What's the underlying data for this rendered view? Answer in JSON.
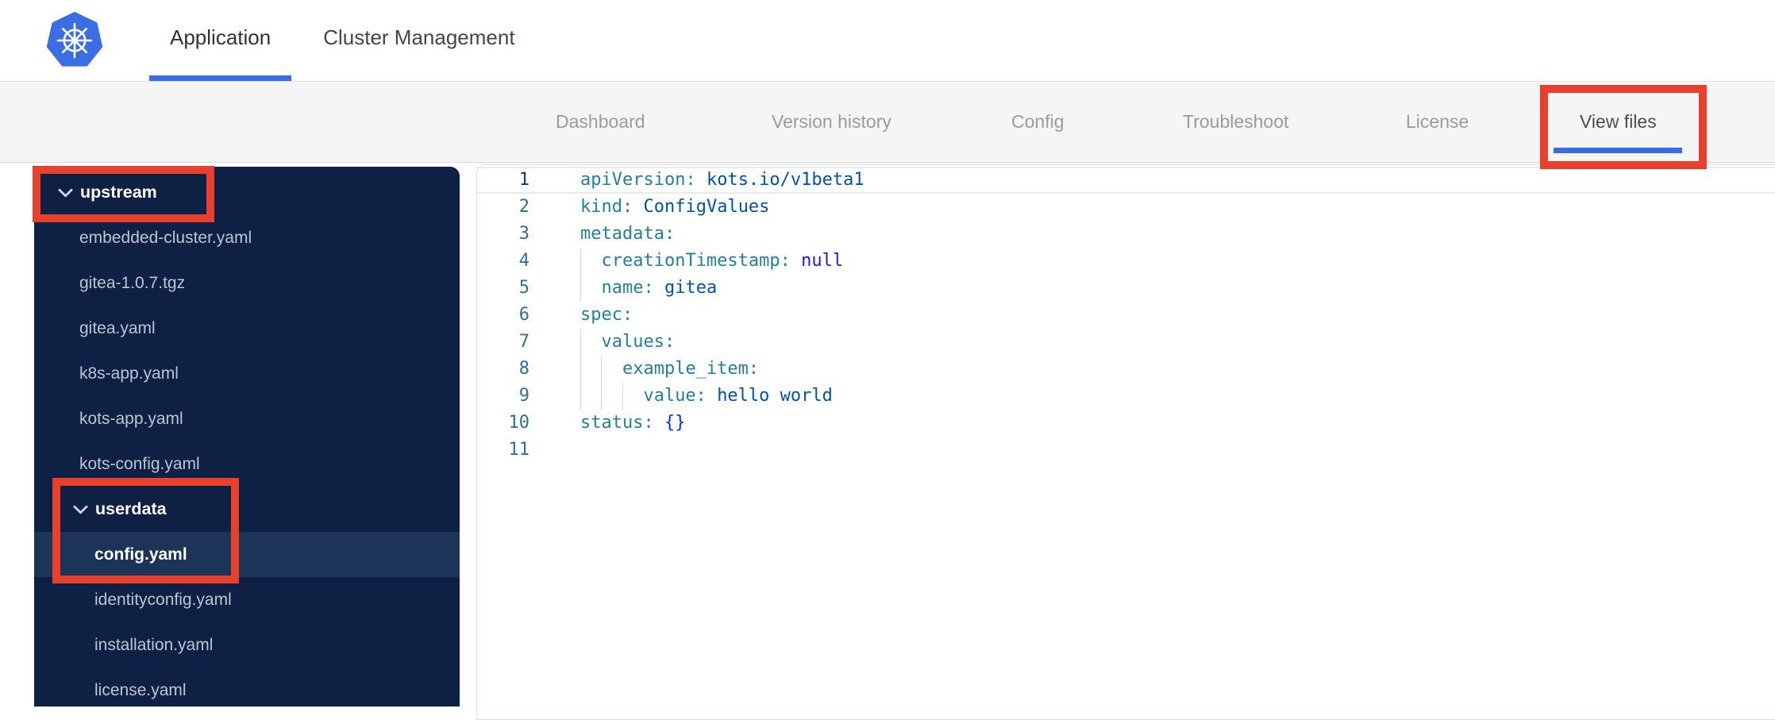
{
  "header": {
    "logo": "kubernetes-logo",
    "tabs": [
      {
        "label": "Application",
        "active": true
      },
      {
        "label": "Cluster Management",
        "active": false
      }
    ]
  },
  "subnav": {
    "tabs": [
      {
        "label": "Dashboard",
        "active": false
      },
      {
        "label": "Version history",
        "active": false
      },
      {
        "label": "Config",
        "active": false
      },
      {
        "label": "Troubleshoot",
        "active": false
      },
      {
        "label": "License",
        "active": false
      },
      {
        "label": "View files",
        "active": true,
        "annotated": true
      }
    ]
  },
  "file_tree": {
    "items": [
      {
        "kind": "folder",
        "label": "upstream",
        "level": 0,
        "expanded": true,
        "annotated": true
      },
      {
        "kind": "file",
        "label": "embedded-cluster.yaml",
        "level": 1
      },
      {
        "kind": "file",
        "label": "gitea-1.0.7.tgz",
        "level": 1
      },
      {
        "kind": "file",
        "label": "gitea.yaml",
        "level": 1
      },
      {
        "kind": "file",
        "label": "k8s-app.yaml",
        "level": 1
      },
      {
        "kind": "file",
        "label": "kots-app.yaml",
        "level": 1
      },
      {
        "kind": "file",
        "label": "kots-config.yaml",
        "level": 1
      },
      {
        "kind": "folder",
        "label": "userdata",
        "level": 1,
        "expanded": true,
        "annotated": true
      },
      {
        "kind": "file",
        "label": "config.yaml",
        "level": 2,
        "selected": true,
        "annotated": true
      },
      {
        "kind": "file",
        "label": "identityconfig.yaml",
        "level": 2
      },
      {
        "kind": "file",
        "label": "installation.yaml",
        "level": 2
      },
      {
        "kind": "file",
        "label": "license.yaml",
        "level": 2
      }
    ]
  },
  "editor": {
    "language": "yaml",
    "lines": [
      {
        "n": 1,
        "indent": 0,
        "active": true,
        "tokens": [
          [
            "key",
            "apiVersion:"
          ],
          [
            "plain",
            " "
          ],
          [
            "val",
            "kots.io/v1beta1"
          ]
        ]
      },
      {
        "n": 2,
        "indent": 0,
        "tokens": [
          [
            "key",
            "kind:"
          ],
          [
            "plain",
            " "
          ],
          [
            "val",
            "ConfigValues"
          ]
        ]
      },
      {
        "n": 3,
        "indent": 0,
        "tokens": [
          [
            "key",
            "metadata:"
          ]
        ]
      },
      {
        "n": 4,
        "indent": 1,
        "tokens": [
          [
            "key",
            "creationTimestamp:"
          ],
          [
            "plain",
            " "
          ],
          [
            "kw",
            "null"
          ]
        ]
      },
      {
        "n": 5,
        "indent": 1,
        "tokens": [
          [
            "key",
            "name:"
          ],
          [
            "plain",
            " "
          ],
          [
            "val",
            "gitea"
          ]
        ]
      },
      {
        "n": 6,
        "indent": 0,
        "tokens": [
          [
            "key",
            "spec:"
          ]
        ]
      },
      {
        "n": 7,
        "indent": 1,
        "tokens": [
          [
            "key",
            "values:"
          ]
        ]
      },
      {
        "n": 8,
        "indent": 2,
        "tokens": [
          [
            "key",
            "example_item:"
          ]
        ]
      },
      {
        "n": 9,
        "indent": 3,
        "tokens": [
          [
            "key",
            "value:"
          ],
          [
            "plain",
            " "
          ],
          [
            "val",
            "hello world"
          ]
        ]
      },
      {
        "n": 10,
        "indent": 0,
        "tokens": [
          [
            "key",
            "status:"
          ],
          [
            "plain",
            " "
          ],
          [
            "bracket",
            "{}"
          ]
        ]
      },
      {
        "n": 11,
        "indent": 0,
        "tokens": []
      }
    ]
  },
  "annotations": [
    {
      "target": "view-files-tab"
    },
    {
      "target": "upstream-folder"
    },
    {
      "target": "userdata-config-yaml"
    }
  ],
  "colors": {
    "accent_blue": "#3a6ce8",
    "logo_blue": "#3b6de4",
    "annotation_red": "#e8402d",
    "sidebar_bg": "#0e2144",
    "sidebar_selected_bg": "#1b3458",
    "sidebar_file_text": "#bdc5d1",
    "token_key": "#267f99",
    "token_value": "#0451a5",
    "token_keyword": "#1d1dd6",
    "token_bracket": "#0431fa",
    "line_number": "#2f7093",
    "line_number_active": "#15386b"
  }
}
